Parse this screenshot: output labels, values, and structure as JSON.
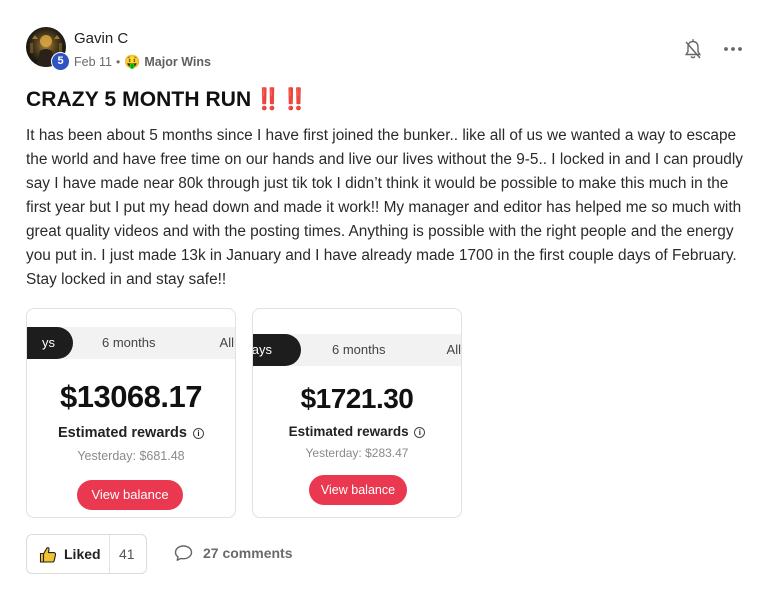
{
  "post": {
    "author": {
      "name": "Gavin C",
      "level": "5"
    },
    "date": "Feb 11",
    "separator": "•",
    "category_emoji": "🤑",
    "category": "Major Wins",
    "title": "CRAZY 5 MONTH RUN",
    "title_emphasis": "‼️‼️",
    "body": "It has been about 5 months since I have first joined the bunker.. like all of us we wanted a way to escape the world and have free time on our hands and live our lives without the 9-5.. I locked in and I can proudly say I have made near 80k through just tik tok I didn’t think it would be possible to make this much in the first year but I put my head down and made it work!! My manager and editor has helped me so much with great quality videos and with the posting times. Anything is possible with the right people and the energy you put in. I just made 13k in January and I have already made 1700 in the first couple days of February. Stay locked in and stay safe!!"
  },
  "attachments": [
    {
      "tabs": {
        "active": "ys",
        "middle": "6 months",
        "right": "All"
      },
      "amount": "$13068.17",
      "label": "Estimated rewards",
      "info_icon": "ⓘ",
      "yesterday": "Yesterday: $681.48",
      "button": "View balance"
    },
    {
      "tabs": {
        "active": "ays",
        "middle": "6 months",
        "right": "All"
      },
      "amount": "$1721.30",
      "label": "Estimated rewards",
      "info_icon": "ⓘ",
      "yesterday": "Yesterday: $283.47",
      "button": "View balance"
    }
  ],
  "actions": {
    "like_label": "Liked",
    "like_count": "41",
    "comments_label": "27 comments"
  },
  "colors": {
    "accent_red": "#e9384f",
    "level_badge": "#2f53c0",
    "title_mark": "#e0392f"
  }
}
